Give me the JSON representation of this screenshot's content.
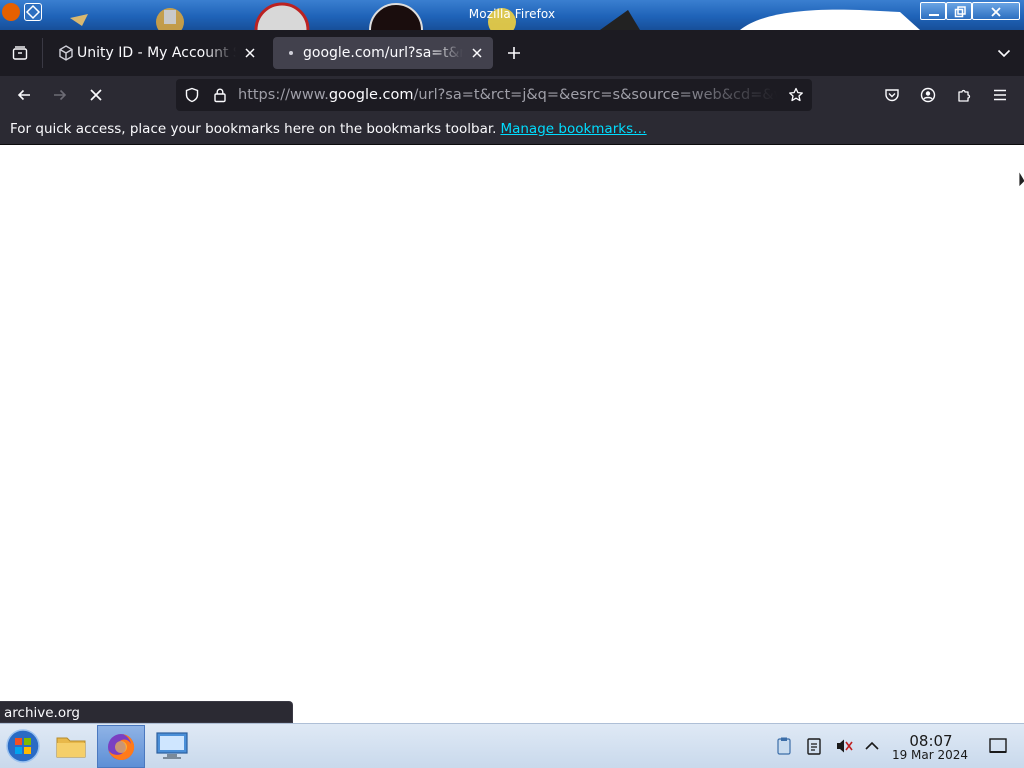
{
  "window": {
    "title": "Mozilla Firefox"
  },
  "tabs": [
    {
      "label": "Unity ID - My Account Se",
      "favicon": "unity-icon",
      "active": false
    },
    {
      "label": "google.com/url?sa=t&rct",
      "favicon": "loading-dot-icon",
      "active": true
    }
  ],
  "navbar": {
    "url_prefix": "https://www.",
    "url_host": "google.com",
    "url_rest": "/url?sa=t&rct=j&q=&esrc=s&source=web&cd=&ved"
  },
  "bookmarks_bar": {
    "message": "For quick access, place your bookmarks here on the bookmarks toolbar.",
    "manage_link": "Manage bookmarks…"
  },
  "status": {
    "link_preview": "archive.org"
  },
  "taskbar": {
    "clock_time": "08:07",
    "clock_date": "19 Mar 2024",
    "items": [
      "start-button",
      "file-manager",
      "firefox",
      "remote-desktop"
    ]
  },
  "colors": {
    "tabstrip_bg": "#1c1b22",
    "toolbar_bg": "#2b2a33",
    "active_tab_bg": "#42414d",
    "link": "#00ddff"
  }
}
